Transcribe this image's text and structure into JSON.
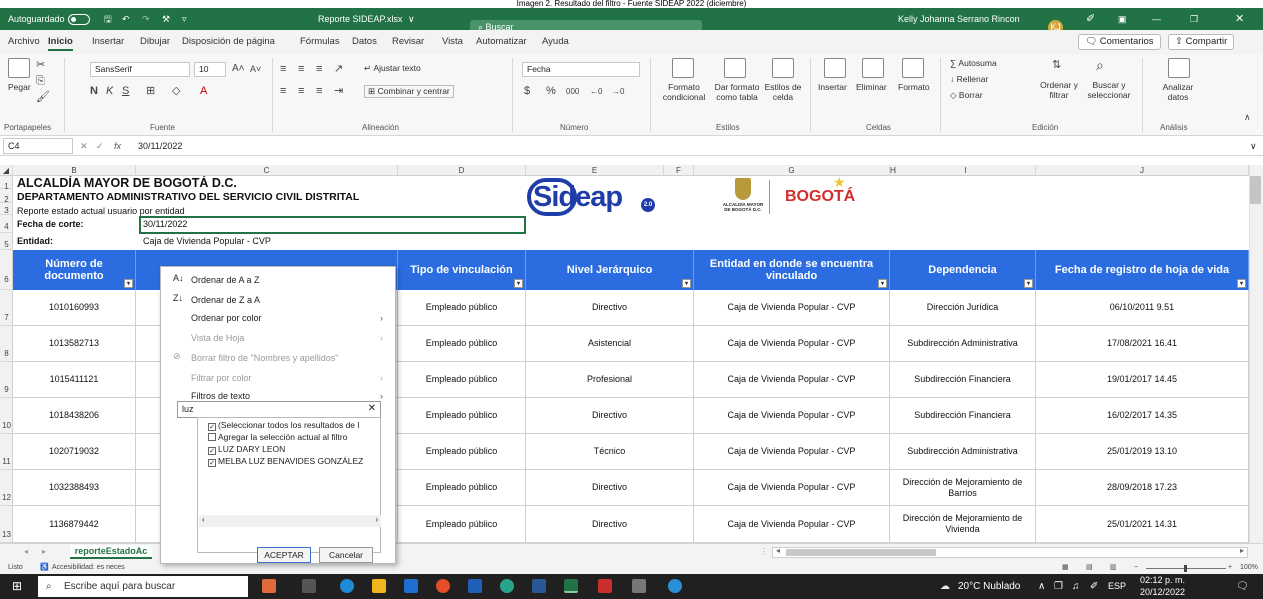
{
  "caption": "Imagen 2. Resultado del filtro - Fuente SIDEAP 2022 (diciembre)",
  "titlebar": {
    "autosave_label": "Autoguardado",
    "doc_title": "Reporte SIDEAP.xlsx",
    "search_placeholder": "Buscar",
    "user_name": "Kelly Johanna Serrano Rincon",
    "user_initials": "KJ"
  },
  "menu": {
    "items": [
      "Archivo",
      "Inicio",
      "Insertar",
      "Dibujar",
      "Disposición de página",
      "Fórmulas",
      "Datos",
      "Revisar",
      "Vista",
      "Automatizar",
      "Ayuda"
    ],
    "comentarios": "Comentarios",
    "compartir": "Compartir"
  },
  "ribbon": {
    "pegar": "Pegar",
    "font_name": "SansSerif",
    "font_size": "10",
    "ajustar_texto": "Ajustar texto",
    "combinar": "Combinar y centrar",
    "number_format": "Fecha",
    "formato_condicional": "Formato condicional",
    "dar_formato_tabla": "Dar formato como tabla",
    "estilos_celda": "Estilos de celda",
    "insertar": "Insertar",
    "eliminar": "Eliminar",
    "formato": "Formato",
    "autosuma": "Autosuma",
    "rellenar": "Rellenar",
    "borrar": "Borrar",
    "ordenar_filtrar": "Ordenar y filtrar",
    "buscar_seleccionar": "Buscar y seleccionar",
    "analizar_datos": "Analizar datos",
    "groups": [
      "Portapapeles",
      "Fuente",
      "Alineación",
      "Número",
      "Estilos",
      "Celdas",
      "Edición",
      "Análisis"
    ]
  },
  "formula_bar": {
    "cell_ref": "C4",
    "fx": "fx",
    "value": "30/11/2022"
  },
  "columns": [
    "B",
    "C",
    "D",
    "E",
    "F",
    "G",
    "H",
    "I",
    "J"
  ],
  "rows": [
    "1",
    "2",
    "3",
    "4",
    "5",
    "6",
    "7",
    "8",
    "9",
    "10",
    "11",
    "12",
    "13"
  ],
  "sheet": {
    "title1": "ALCALDÍA MAYOR DE BOGOTÁ D.C.",
    "title2": "DEPARTAMENTO ADMINISTRATIVO DEL SERVICIO CIVIL DISTRITAL",
    "subtitle": "Reporte estado actual usuario por entidad",
    "fecha_label": "Fecha de corte:",
    "fecha_value": "30/11/2022",
    "entidad_label": "Entidad:",
    "entidad_value": "Caja de Vivienda Popular - CVP",
    "logo_sideap": "Sideap",
    "logo_sideap_version": "2.0",
    "logo_alcaldia": "ALCALDÍA MAYOR DE BOGOTÁ D.C.",
    "logo_bogota": "BOGOTÁ"
  },
  "table": {
    "headers": [
      "Número de documento",
      "",
      "Tipo de vinculación",
      "Nivel Jerárquico",
      "Entidad en donde se encuentra vinculado",
      "Dependencia",
      "Fecha de registro de hoja de vida"
    ],
    "rows": [
      [
        "1010160993",
        "Empleado público",
        "Directivo",
        "Caja de Vivienda Popular - CVP",
        "Dirección Jurídica",
        "06/10/2011 9.51"
      ],
      [
        "1013582713",
        "Empleado público",
        "Asistencial",
        "Caja de Vivienda Popular - CVP",
        "Subdirección Administrativa",
        "17/08/2021 16.41"
      ],
      [
        "1015411121",
        "Empleado público",
        "Profesional",
        "Caja de Vivienda Popular - CVP",
        "Subdirección Financiera",
        "19/01/2017 14.45"
      ],
      [
        "1018438206",
        "Empleado público",
        "Directivo",
        "Caja de Vivienda Popular - CVP",
        "Subdirección Financiera",
        "16/02/2017 14.35"
      ],
      [
        "1020719032",
        "Empleado público",
        "Técnico",
        "Caja de Vivienda Popular - CVP",
        "Subdirección Administrativa",
        "25/01/2019 13.10"
      ],
      [
        "1032388493",
        "Empleado público",
        "Directivo",
        "Caja de Vivienda Popular - CVP",
        "Dirección de Mejoramiento de Barrios",
        "28/09/2018 17.23"
      ],
      [
        "1136879442",
        "Empleado público",
        "Directivo",
        "Caja de Vivienda Popular - CVP",
        "Dirección de Mejoramiento de Vivienda",
        "25/01/2021 14.31"
      ]
    ]
  },
  "filter": {
    "sort_az": "Ordenar de A a Z",
    "sort_za": "Ordenar de Z a A",
    "sort_color": "Ordenar por color",
    "sheet_view": "Vista de Hoja",
    "clear_filter": "Borrar filtro de \"Nombres y apellidos\"",
    "filter_color": "Filtrar por color",
    "text_filters": "Filtros de texto",
    "search_value": "luz",
    "items": [
      "(Seleccionar todos los resultados de l",
      "Agregar la selección actual al filtro",
      "LUZ DARY LEON",
      "MELBA LUZ BENAVIDES GONZÁLEZ"
    ],
    "accept": "ACEPTAR",
    "cancel": "Cancelar"
  },
  "status": {
    "listo": "Listo",
    "accesibilidad": "Accesibilidad: es neces",
    "zoom": "100%"
  },
  "sheet_tab": "reporteEstadoAc",
  "taskbar": {
    "search": "Escribe aquí para buscar",
    "weather": "20°C Nublado",
    "lang": "ESP",
    "time": "02:12 p. m.",
    "date": "20/12/2022"
  },
  "colors": {
    "excel_green": "#217346",
    "header_blue": "#2b6de0",
    "sideap_blue": "#1f3da8",
    "bogota_red": "#d42d2d"
  }
}
